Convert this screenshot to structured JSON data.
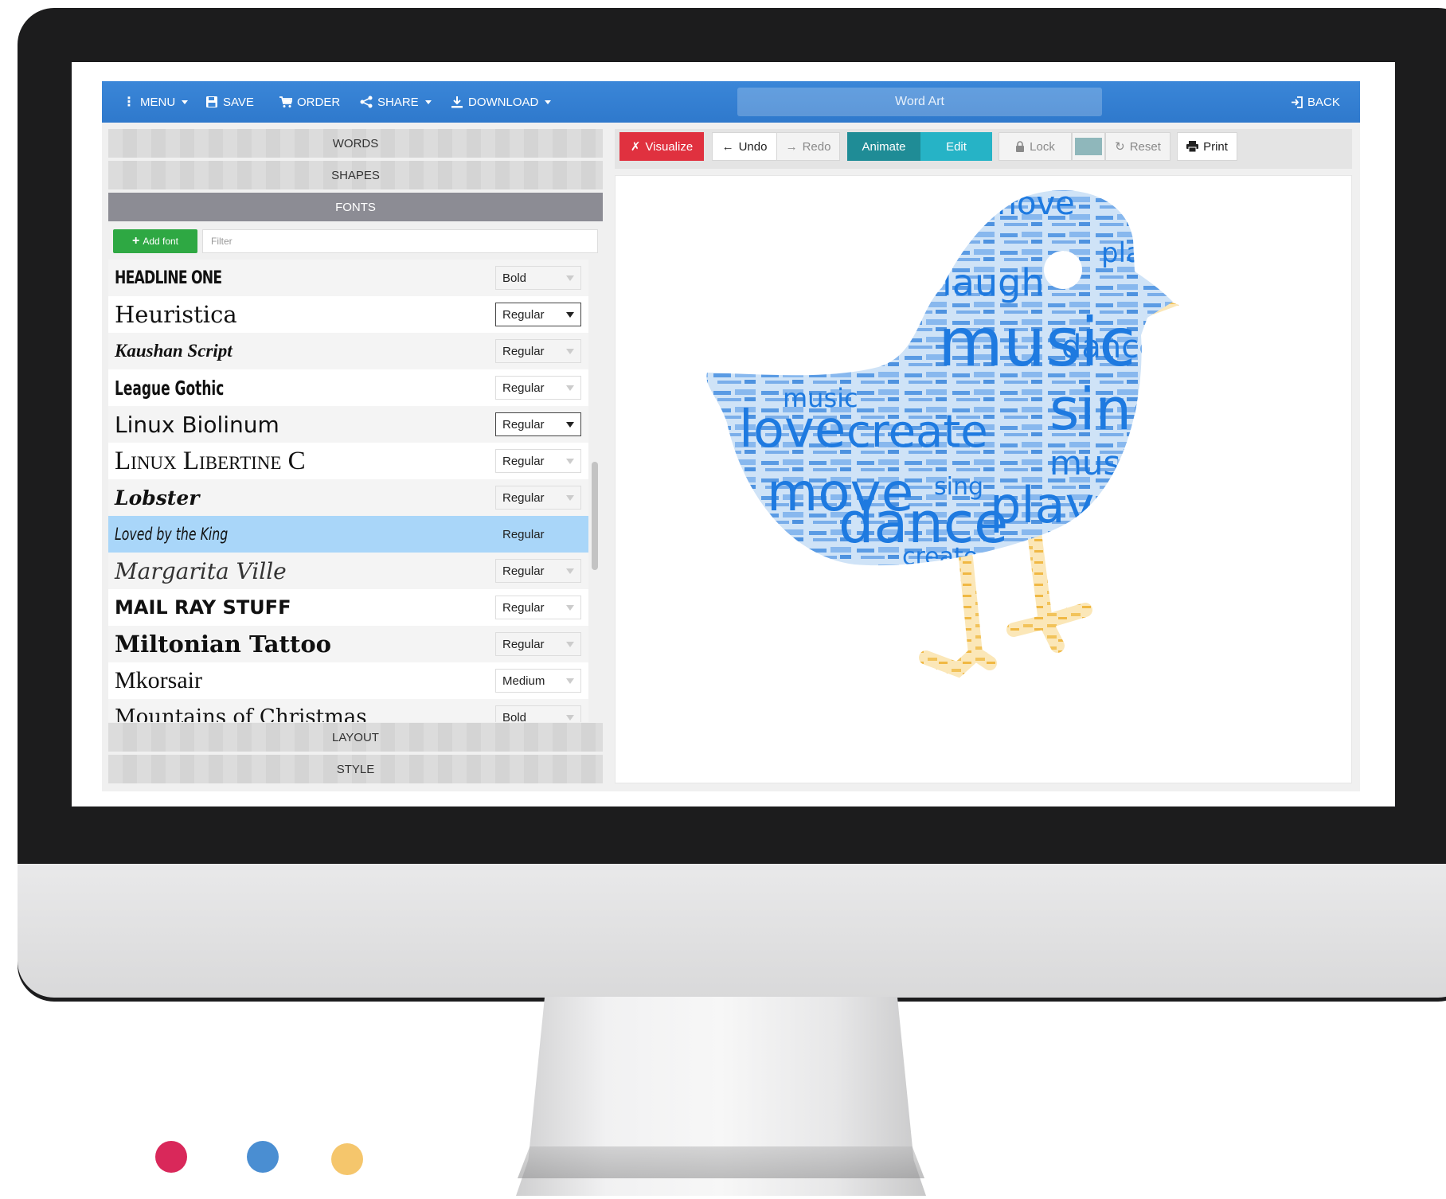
{
  "navbar": {
    "menu": "MENU",
    "save": "SAVE",
    "order": "ORDER",
    "share": "SHARE",
    "download": "DOWNLOAD",
    "title": "Word Art",
    "back": "BACK"
  },
  "sections": {
    "words": "WORDS",
    "shapes": "SHAPES",
    "fonts": "FONTS",
    "layout": "LAYOUT",
    "style": "STYLE"
  },
  "fonts_panel": {
    "add_font": "Add font",
    "filter_placeholder": "Filter",
    "rows": [
      {
        "name": "HEADLINE ONE",
        "weight": "Bold"
      },
      {
        "name": "Heuristica",
        "weight": "Regular"
      },
      {
        "name": "Kaushan Script",
        "weight": "Regular"
      },
      {
        "name": "League Gothic",
        "weight": "Regular"
      },
      {
        "name": "Linux Biolinum",
        "weight": "Regular"
      },
      {
        "name": "Linux Libertine C",
        "weight": "Regular"
      },
      {
        "name": "Lobster",
        "weight": "Regular"
      },
      {
        "name": "Loved by the King",
        "weight": "Regular"
      },
      {
        "name": "Margarita Ville",
        "weight": "Regular"
      },
      {
        "name": "MAIL RAY STUFF",
        "weight": "Regular"
      },
      {
        "name": "Miltonian Tattoo",
        "weight": "Regular"
      },
      {
        "name": "Mkorsair",
        "weight": "Medium"
      },
      {
        "name": "Mountains of Christmas",
        "weight": "Bold"
      }
    ]
  },
  "toolbar": {
    "visualize": "Visualize",
    "undo": "Undo",
    "redo": "Redo",
    "animate": "Animate",
    "edit": "Edit",
    "lock": "Lock",
    "reset": "Reset",
    "print": "Print"
  },
  "word_cloud": {
    "words": [
      "music",
      "sing",
      "dance",
      "move",
      "create",
      "love",
      "play",
      "laugh"
    ]
  },
  "colors": {
    "navbar": "#3a86d8",
    "visualize": "#e0313f",
    "animate": "#1f8c96",
    "edit": "#26b3c6",
    "add_font": "#2ea843",
    "selected_row": "#a9d6f9",
    "cloud_blue": "#1e7ae0",
    "cloud_gold": "#f2c35a",
    "dot_red": "#d9285a",
    "dot_blue": "#4a8ed2",
    "dot_yellow": "#f5c66c"
  }
}
